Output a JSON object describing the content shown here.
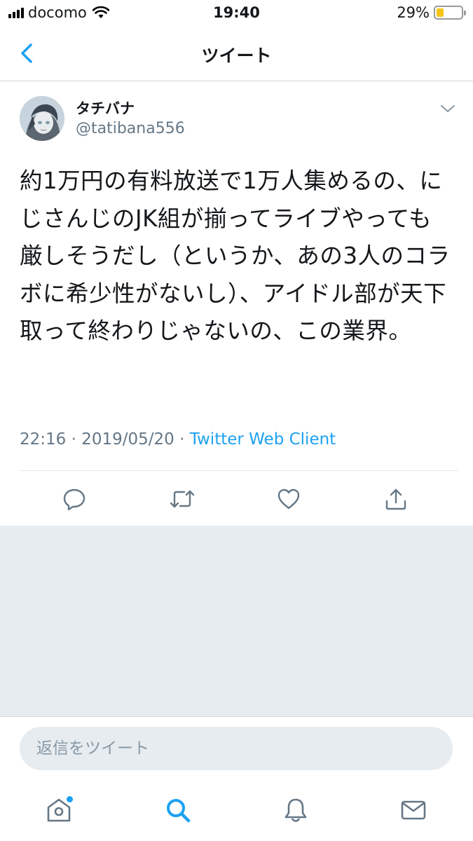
{
  "status_bar": {
    "carrier": "docomo",
    "time": "19:40",
    "battery_percent": "29%",
    "battery_level": 0.29,
    "battery_color": "#f5c518",
    "icons": [
      "signal-icon",
      "wifi-icon",
      "battery-icon"
    ]
  },
  "nav": {
    "title": "ツイート",
    "back_icon": "chevron-left-icon"
  },
  "tweet": {
    "display_name": "タチバナ",
    "handle": "@tatibana556",
    "text": "約1万円の有料放送で1万人集めるの、にじさんじのJK組が揃ってライブやっても厳しそうだし（というか、あの3人のコラボに希少性がないし）、アイドル部が天下取って終わりじゃないの、この業界。",
    "time": "22:16",
    "separator": "·",
    "date": "2019/05/20",
    "client": "Twitter Web Client",
    "actions": [
      "reply-icon",
      "retweet-icon",
      "like-icon",
      "share-icon"
    ]
  },
  "reply": {
    "placeholder": "返信をツイート"
  },
  "tabbar": {
    "items": [
      "home-icon",
      "search-icon",
      "notifications-icon",
      "messages-icon"
    ],
    "active": "search-icon"
  },
  "colors": {
    "accent": "#1da1f2",
    "secondary_text": "#657786",
    "background_grey": "#e6ecf0"
  }
}
